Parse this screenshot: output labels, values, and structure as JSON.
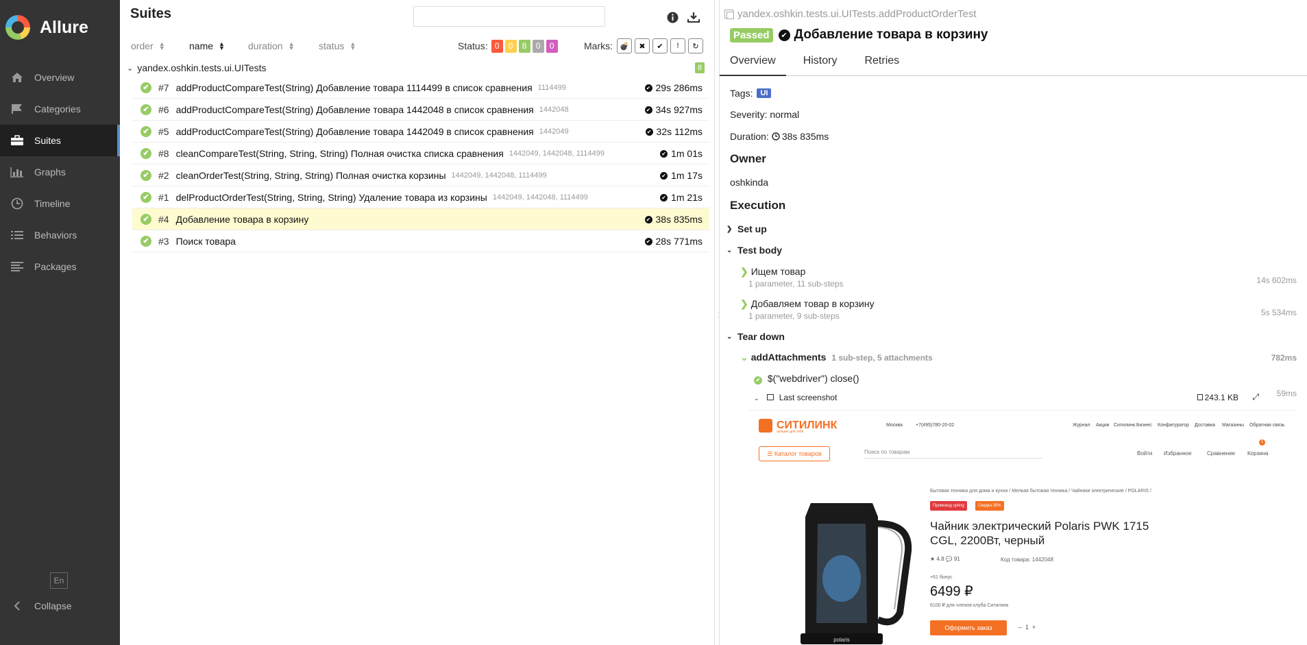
{
  "app": {
    "name": "Allure"
  },
  "sidebar": {
    "items": [
      {
        "label": "Overview",
        "icon": "home-icon"
      },
      {
        "label": "Categories",
        "icon": "flag-icon"
      },
      {
        "label": "Suites",
        "icon": "briefcase-icon",
        "active": true
      },
      {
        "label": "Graphs",
        "icon": "bar-chart-icon"
      },
      {
        "label": "Timeline",
        "icon": "clock-icon"
      },
      {
        "label": "Behaviors",
        "icon": "list-icon"
      },
      {
        "label": "Packages",
        "icon": "align-left-icon"
      }
    ],
    "lang": "En",
    "collapse": "Collapse"
  },
  "suites": {
    "title": "Suites",
    "sort": {
      "order": "order",
      "name": "name",
      "duration": "duration",
      "status": "status"
    },
    "status_label": "Status:",
    "status_counts": [
      {
        "value": "0",
        "color": "#fd5a3e"
      },
      {
        "value": "0",
        "color": "#ffd050"
      },
      {
        "value": "8",
        "color": "#97cc64"
      },
      {
        "value": "0",
        "color": "#aaaaaa"
      },
      {
        "value": "0",
        "color": "#d35ebe"
      }
    ],
    "marks_label": "Marks:",
    "group": {
      "name": "yandex.oshkin.tests.ui.UITests",
      "count": "8"
    },
    "tests": [
      {
        "num": "#7",
        "name": "addProductCompareTest(String) Добавление товара 1114499 в список сравнения",
        "params": "1114499",
        "duration": "29s 286ms"
      },
      {
        "num": "#6",
        "name": "addProductCompareTest(String) Добавление товара 1442048 в список сравнения",
        "params": "1442048",
        "duration": "34s 927ms"
      },
      {
        "num": "#5",
        "name": "addProductCompareTest(String) Добавление товара 1442049 в список сравнения",
        "params": "1442049",
        "duration": "32s 112ms"
      },
      {
        "num": "#8",
        "name": "cleanCompareTest(String, String, String) Полная очистка списка сравнения",
        "params": "1442049, 1442048, 1114499",
        "duration": "1m 01s"
      },
      {
        "num": "#2",
        "name": "cleanOrderTest(String, String, String) Полная очистка корзины",
        "params": "1442049, 1442048, 1114499",
        "duration": "1m 17s"
      },
      {
        "num": "#1",
        "name": "delProductOrderTest(String, String, String) Удаление товара из корзины",
        "params": "1442049, 1442048, 1114499",
        "duration": "1m 21s"
      },
      {
        "num": "#4",
        "name": "Добавление товара в корзину",
        "params": "",
        "duration": "38s 835ms",
        "selected": true
      },
      {
        "num": "#3",
        "name": "Поиск товара",
        "params": "",
        "duration": "28s 771ms"
      }
    ]
  },
  "detail": {
    "breadcrumb": "yandex.oshkin.tests.ui.UITests.addProductOrderTest",
    "status": "Passed",
    "title": "Добавление товара в корзину",
    "tabs": [
      "Overview",
      "History",
      "Retries"
    ],
    "tags_label": "Tags:",
    "tag": "UI",
    "severity": "Severity: normal",
    "duration_label": "Duration:",
    "duration": "38s 835ms",
    "owner_title": "Owner",
    "owner": "oshkinda",
    "execution_title": "Execution",
    "setup": "Set up",
    "test_body": "Test body",
    "steps": [
      {
        "name": "Ищем товар",
        "sub": "1 parameter, 11 sub-steps",
        "duration": "14s 602ms"
      },
      {
        "name": "Добавляем товар в корзину",
        "sub": "1 parameter, 9 sub-steps",
        "duration": "5s 534ms"
      }
    ],
    "teardown": "Tear down",
    "attach_step": {
      "name": "addAttachments",
      "sub": "1 sub-step, 5 attachments",
      "duration": "782ms"
    },
    "close_step": "$(\"webdriver\") close()",
    "screenshot": {
      "name": "Last screenshot",
      "size": "243.1 KB",
      "time": "59ms"
    }
  },
  "site": {
    "logo": "СИТИЛИНК",
    "logo_sub": "лучшие для тебя",
    "city": "Москва",
    "phone": "+7(495)780-20-02",
    "top_links": [
      "Журнал",
      "Акции",
      "Ситилинк.Бизнес",
      "Конфигуратор",
      "Доставка",
      "Магазины",
      "Обратная связь"
    ],
    "catalog": "Каталог товаров",
    "search_placeholder": "Поиск по товарам",
    "nav": [
      "Войти",
      "Избранное",
      "Сравнение",
      "Корзина"
    ],
    "cart_count": "1",
    "crumbs": "Бытовая техника для дома и кухни / Мелкая бытовая техника / Чайники электрические / POLARIS /",
    "chip1": "Промокод spring",
    "chip2": "Скидка 30%",
    "product": "Чайник электрический Polaris PWK 1715 CGL, 2200Вт, черный",
    "rating": "★ 4.8    💬 91",
    "code": "Код товара: 1442048",
    "bonus": "+61 бонус",
    "price": "6499 ₽",
    "club": "6100 ₽ для членов клуба Ситилинк",
    "order": "Оформить заказ",
    "brand_label": "polaris"
  },
  "colors": {
    "sidebar": "#343434",
    "accent": "#97cc64",
    "selected_row": "#fffbd1",
    "site_orange": "#f47023"
  }
}
